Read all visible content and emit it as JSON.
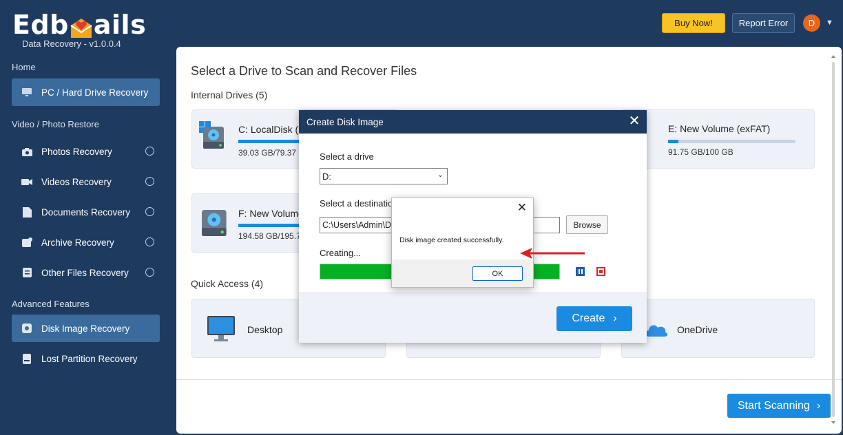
{
  "app": {
    "logo_text_pre": "Edb",
    "logo_text_post": "ails",
    "subtitle": "Data Recovery - v1.0.0.4"
  },
  "header": {
    "buy_now": "Buy Now!",
    "report_error": "Report Error",
    "avatar_initial": "D"
  },
  "sidebar": {
    "home_heading": "Home",
    "pc_recovery": "PC / Hard Drive Recovery",
    "video_heading": "Video / Photo Restore",
    "photos": "Photos Recovery",
    "videos": "Videos Recovery",
    "documents": "Documents Recovery",
    "archive": "Archive Recovery",
    "other": "Other Files Recovery",
    "advanced_heading": "Advanced Features",
    "disk_image": "Disk Image Recovery",
    "lost_partition": "Lost Partition Recovery"
  },
  "main": {
    "title": "Select a Drive to Scan and Recover Files",
    "internal_drives": "Internal Drives (5)",
    "quick_access": "Quick Access (4)",
    "start_scanning": "Start Scanning",
    "drives": [
      {
        "name": "C: LocalDisk (I",
        "size": "39.03 GB/79.37 G",
        "used": 0.49
      },
      {
        "name": "E: New Volume (exFAT)",
        "size": "91.75 GB/100 GB",
        "used": 0.08
      },
      {
        "name": "F: New Volume",
        "size": "194.58 GB/195.79",
        "used": 0.99
      }
    ],
    "quick": [
      {
        "name": "Desktop"
      },
      {
        "name": "OneDrive"
      }
    ]
  },
  "dialog": {
    "title": "Create Disk Image",
    "select_drive_label": "Select a drive",
    "drive_value": "D:",
    "destination_label": "Select a destinatio",
    "path_value": "C:\\Users\\Admin\\D",
    "browse": "Browse",
    "creating": "Creating...",
    "progress": 1.0,
    "create": "Create"
  },
  "message": {
    "text": "Disk image created successfully.",
    "ok": "OK"
  },
  "colors": {
    "sidebar_bg": "#1f3a5f",
    "accent": "#1a8be0",
    "progress": "#06b025",
    "buy": "#f7c325",
    "arrow": "#e01e1e"
  }
}
